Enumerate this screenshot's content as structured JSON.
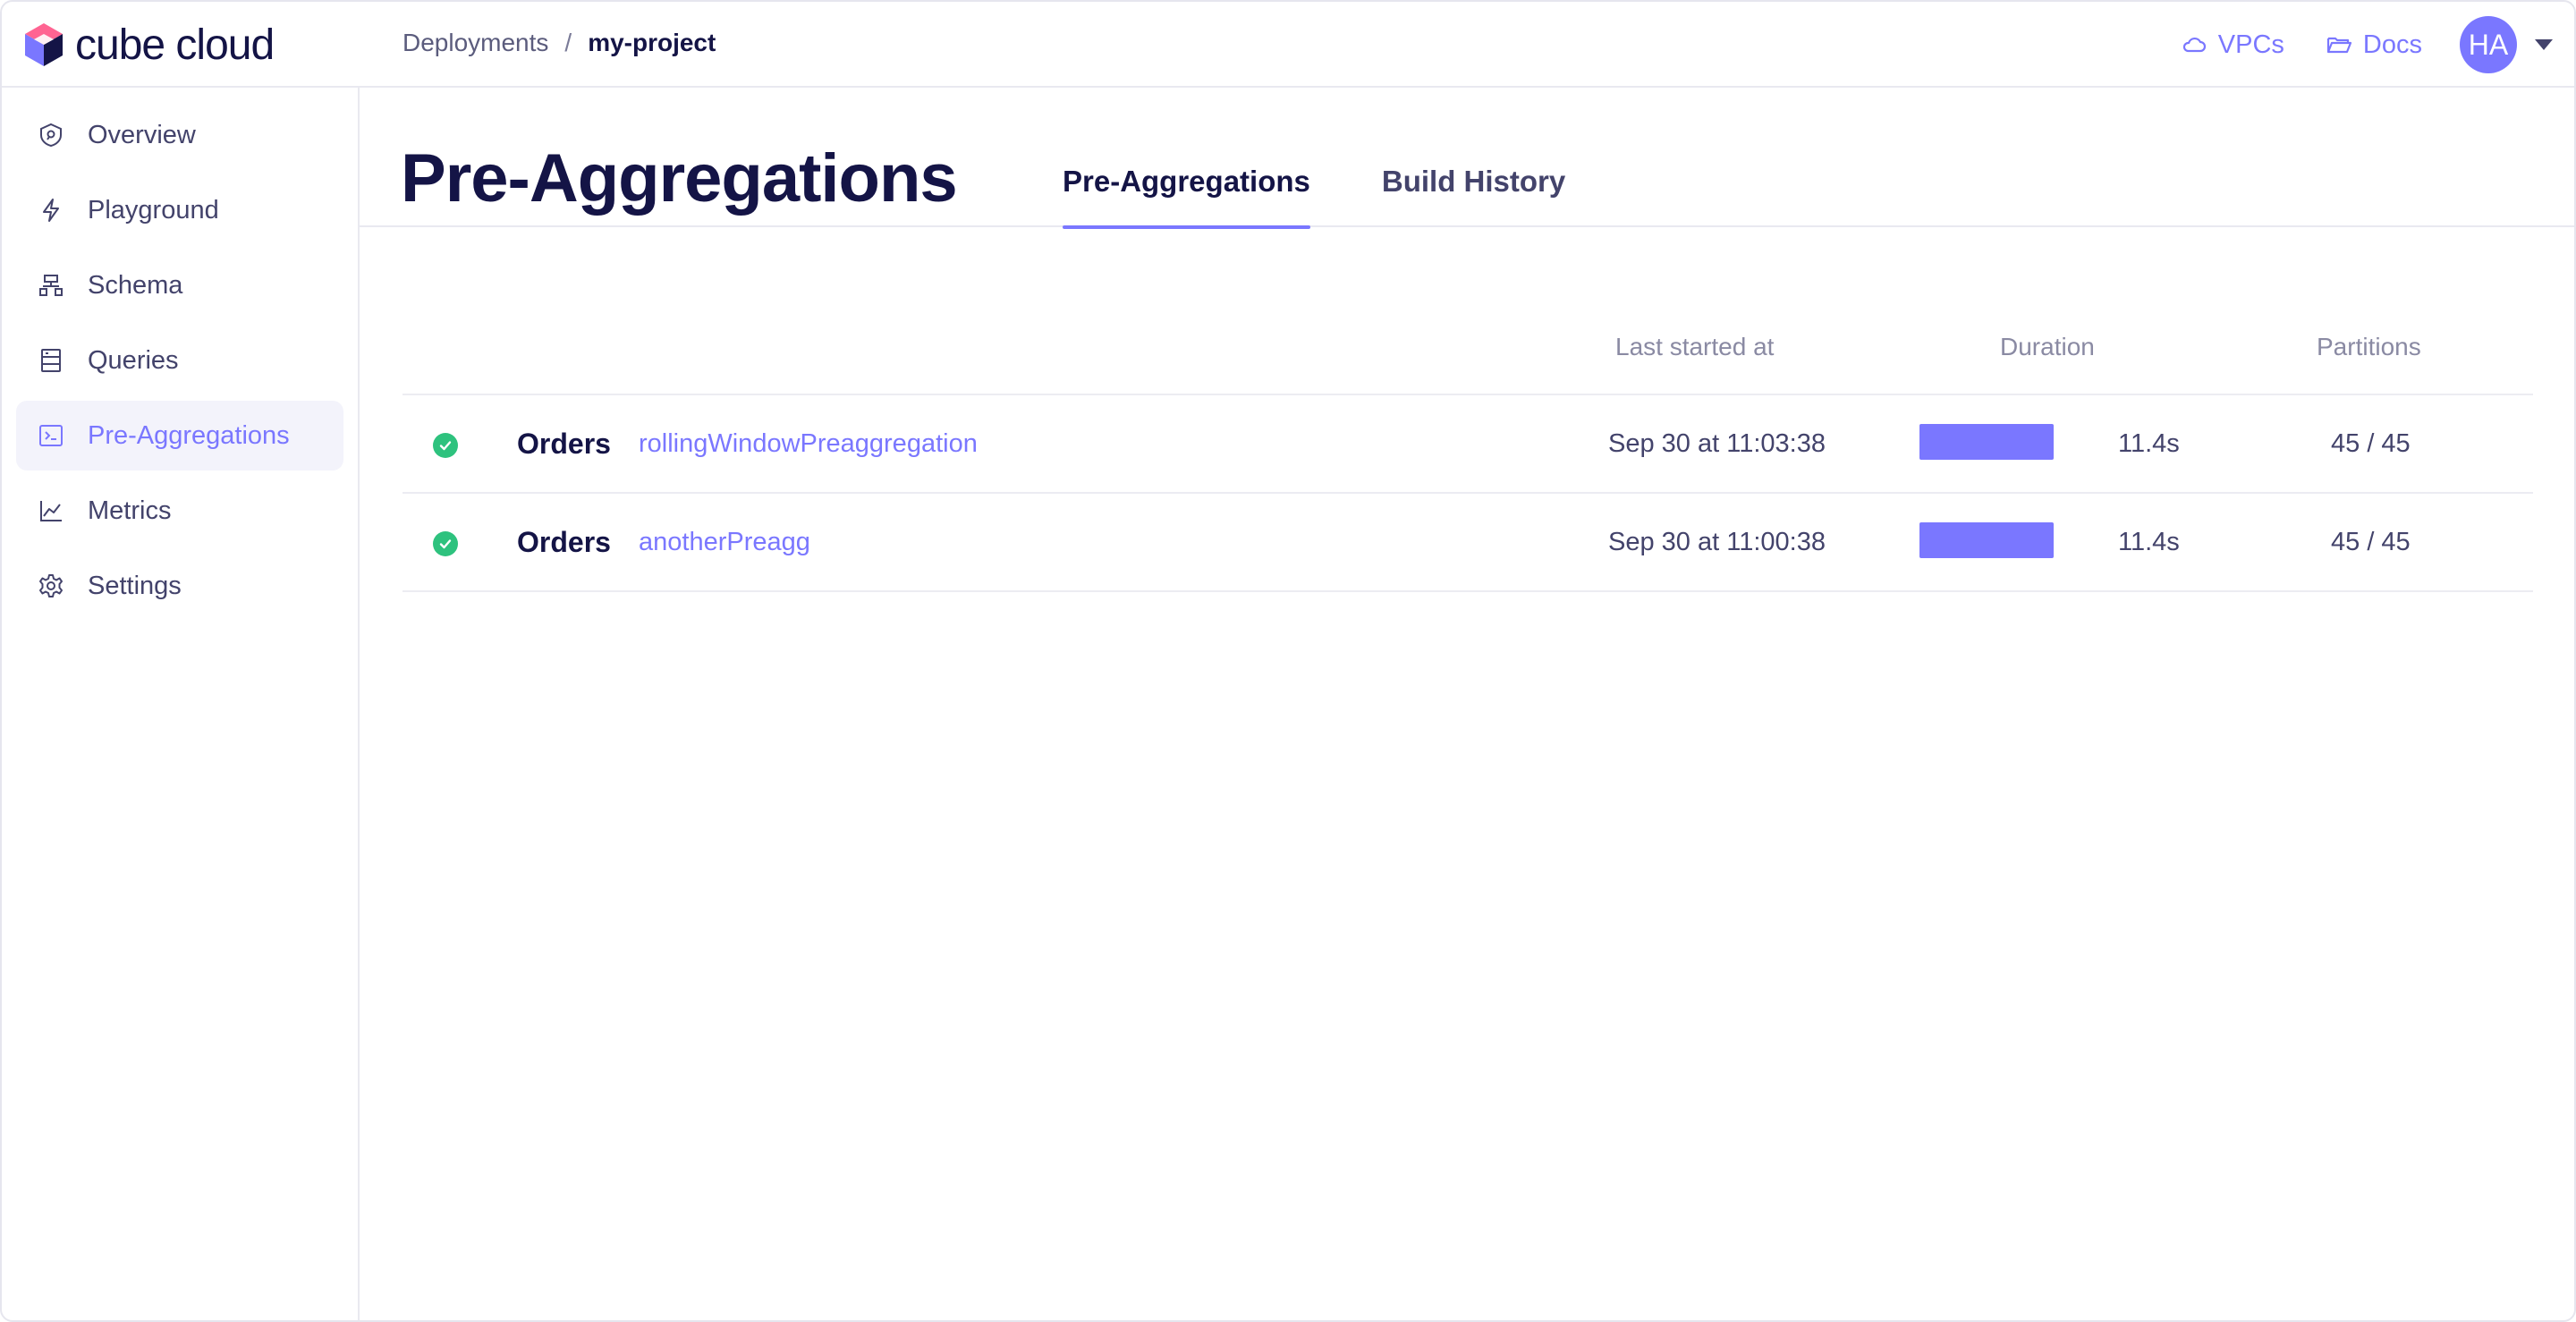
{
  "app": {
    "logo_text": "cube cloud"
  },
  "breadcrumb": {
    "parent": "Deployments",
    "separator": "/",
    "current": "my-project"
  },
  "topnav": {
    "vpcs": "VPCs",
    "docs": "Docs",
    "avatar_initials": "HA"
  },
  "sidebar": {
    "items": [
      {
        "label": "Overview",
        "icon": "overview-shield-icon"
      },
      {
        "label": "Playground",
        "icon": "lightning-icon"
      },
      {
        "label": "Schema",
        "icon": "schema-icon"
      },
      {
        "label": "Queries",
        "icon": "queries-icon"
      },
      {
        "label": "Pre-Aggregations",
        "icon": "terminal-icon",
        "active": true
      },
      {
        "label": "Metrics",
        "icon": "chart-icon"
      },
      {
        "label": "Settings",
        "icon": "gear-icon"
      }
    ]
  },
  "page": {
    "title": "Pre-Aggregations",
    "tabs": [
      {
        "label": "Pre-Aggregations",
        "active": true
      },
      {
        "label": "Build History",
        "active": false
      }
    ]
  },
  "table": {
    "headers": {
      "started": "Last started at",
      "duration": "Duration",
      "partitions": "Partitions"
    },
    "rows": [
      {
        "cube": "Orders",
        "preaggregation": "rollingWindowPreaggregation",
        "started": "Sep 30 at 11:03:38",
        "duration": "11.4s",
        "duration_fill": 1.0,
        "partitions": "45 / 45",
        "status": "success"
      },
      {
        "cube": "Orders",
        "preaggregation": "anotherPreagg",
        "started": "Sep 30 at 11:00:38",
        "duration": "11.4s",
        "duration_fill": 1.0,
        "partitions": "45 / 45",
        "status": "success"
      }
    ]
  },
  "colors": {
    "accent": "#7a77ff",
    "text_dark": "#141446",
    "text_muted": "#43436b",
    "success": "#2ec27e"
  }
}
